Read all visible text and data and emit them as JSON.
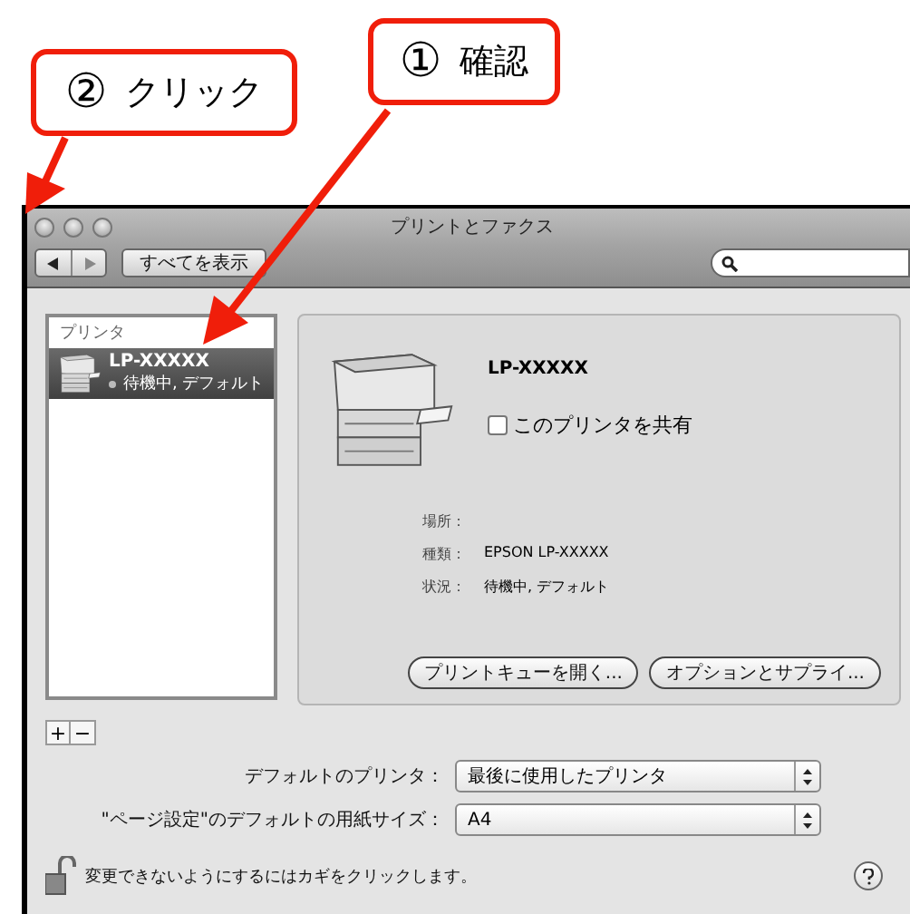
{
  "callouts": [
    {
      "number": "②",
      "label": "クリック"
    },
    {
      "number": "①",
      "label": "確認"
    }
  ],
  "window": {
    "title": "プリントとファクス"
  },
  "toolbar": {
    "show_all": "すべてを表示"
  },
  "printer_list": {
    "header": "プリンタ",
    "items": [
      {
        "name": "LP-XXXXX",
        "status": "待機中, デフォルト",
        "selected": true
      }
    ]
  },
  "detail": {
    "name": "LP-XXXXX",
    "share": {
      "label": "このプリンタを共有",
      "checked": false
    },
    "info": [
      {
        "label": "場所："
      },
      {
        "label": "種類：",
        "value": "EPSON LP-XXXXX"
      },
      {
        "label": "状況：",
        "value": "待機中, デフォルト"
      }
    ],
    "buttons": [
      "プリントキューを開く...",
      "オプションとサプライ..."
    ]
  },
  "list_buttons": [
    "+",
    "−"
  ],
  "settings": [
    {
      "label": "デフォルトのプリンタ：",
      "value": "最後に使用したプリンタ"
    },
    {
      "label": "\"ページ設定\"のデフォルトの用紙サイズ：",
      "value": "A4"
    }
  ],
  "lock_message": "変更できないようにするにはカギをクリックします。"
}
